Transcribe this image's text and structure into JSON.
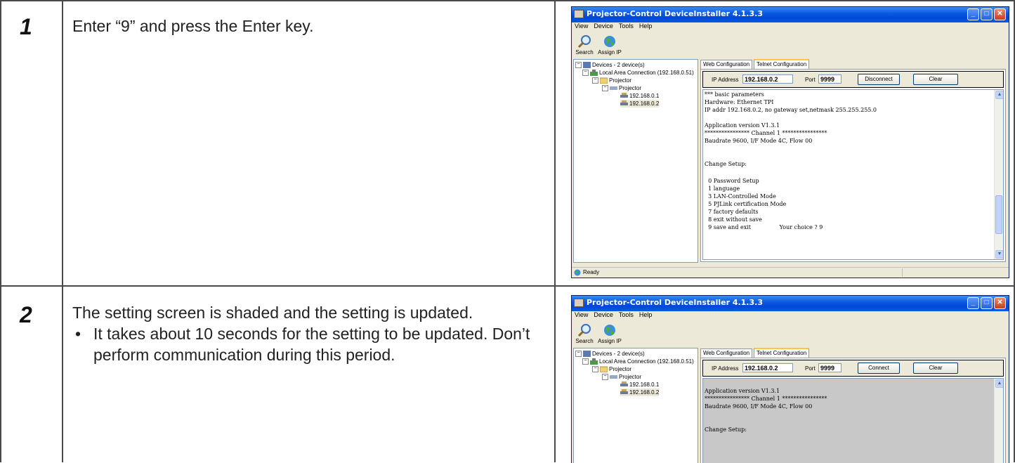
{
  "steps": [
    {
      "number": "1",
      "text": "Enter “9” and press the Enter key."
    },
    {
      "number": "2",
      "text": "The setting screen is shaded and the setting is updated.",
      "bullet": "It takes about 10 seconds for the setting to be updated. Don’t perform communication during this period."
    }
  ],
  "window": {
    "title": "Projector-Control DeviceInstaller 4.1.3.3",
    "menu": [
      "View",
      "Device",
      "Tools",
      "Help"
    ],
    "toolbar": [
      "Search",
      "Assign IP"
    ],
    "tree": [
      "Devices - 2 device(s)",
      "Local Area Connection (192.168.0.51)",
      "Projector",
      "Projector",
      "192.168.0.1",
      "192.168.0.2"
    ],
    "tabs": [
      "Web Configuration",
      "Telnet Configuration"
    ],
    "ip_label": "IP Address",
    "ip_value": "192.168.0.2",
    "port_label": "Port",
    "port_value": "9999",
    "clear_label": "Clear",
    "status": "Ready"
  },
  "screen1": {
    "connect_button": "Disconnect",
    "terminal": [
      "*** basic parameters",
      "Hardware: Ethernet TPI",
      "IP addr 192.168.0.2, no gateway set,netmask 255.255.255.0",
      "",
      "Application version V1.3.1",
      "**************** Channel 1 ****************",
      "Baudrate 9600, I/F Mode 4C, Flow 00",
      "",
      "",
      "Change Setup:",
      "",
      "  0 Password Setup",
      "  1 language",
      "  3 LAN-Controlled Mode",
      "  5 PJLink certification Mode",
      "  7 factory defaults",
      "  8 exit without save",
      "  9 save and exit                Your choice ? 9"
    ]
  },
  "screen2": {
    "connect_button": "Connect",
    "terminal": [
      "Application version V1.3.1",
      "**************** Channel 1 ****************",
      "Baudrate 9600, I/F Mode 4C, Flow 00",
      "",
      "",
      "Change Setup:"
    ]
  },
  "colors": {
    "titlebar": "#0a5ae0",
    "window_bg": "#ece9d8",
    "shaded_terminal": "#c8c8c8",
    "tab_highlight": "#ffc83c"
  }
}
